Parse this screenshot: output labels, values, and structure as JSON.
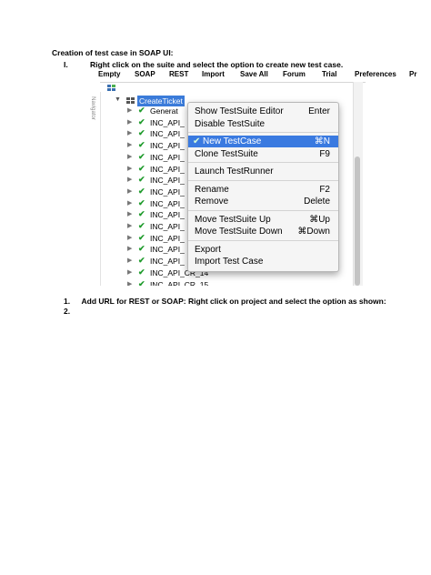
{
  "doc": {
    "heading": "Creation of test case in SOAP UI:",
    "step_number": "I.",
    "step_text": "Right click on the suite and select the option to create new test case.",
    "list": [
      {
        "num": "1.",
        "text": "Add URL for REST or SOAP: Right click on project and select the option as shown:"
      },
      {
        "num": "2.",
        "text": ""
      }
    ]
  },
  "toolbar": [
    "Empty",
    "SOAP",
    "REST",
    "Import",
    "Save All",
    "Forum",
    "Trial",
    "Preferences",
    "Pr"
  ],
  "navigator_label": "Navigator",
  "tree": {
    "suite": "CreateTicket",
    "items": [
      "Generat",
      "INC_API_",
      "INC_API_",
      "INC_API_",
      "INC_API_",
      "INC_API_",
      "INC_API_",
      "INC_API_",
      "INC_API_",
      "INC_API_",
      "INC_API_",
      "INC_API_",
      "INC_API_",
      "INC_API_",
      "INC_API_CR_14",
      "INC_API_CR_15"
    ]
  },
  "menu": {
    "groups": [
      [
        {
          "label": "Show TestSuite Editor",
          "shortcut": "Enter"
        },
        {
          "label": "Disable TestSuite",
          "shortcut": ""
        }
      ],
      [
        {
          "label": "New TestCase",
          "shortcut": "⌘N",
          "highlighted": true
        },
        {
          "label": "Clone TestSuite",
          "shortcut": "F9"
        }
      ],
      [
        {
          "label": "Launch TestRunner",
          "shortcut": ""
        }
      ],
      [
        {
          "label": "Rename",
          "shortcut": "F2"
        },
        {
          "label": "Remove",
          "shortcut": "Delete"
        }
      ],
      [
        {
          "label": "Move TestSuite Up",
          "shortcut": "⌘Up"
        },
        {
          "label": "Move TestSuite Down",
          "shortcut": "⌘Down"
        }
      ],
      [
        {
          "label": "Export",
          "shortcut": ""
        },
        {
          "label": "Import Test Case",
          "shortcut": ""
        }
      ]
    ]
  },
  "colors": {
    "selection": "#3b7bd9",
    "check": "#1f9b2c",
    "menu_highlight": "#3a7ae0"
  }
}
